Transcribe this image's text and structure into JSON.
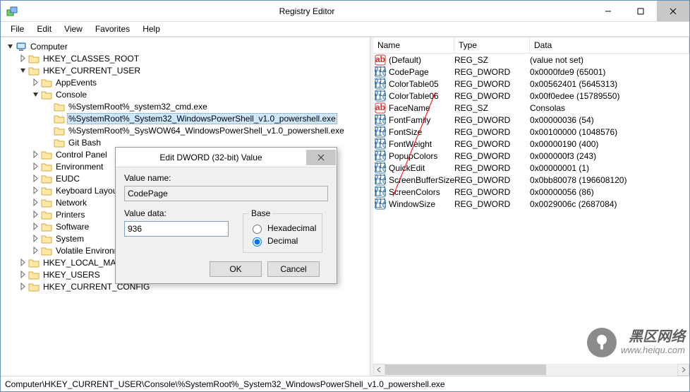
{
  "window": {
    "title": "Registry Editor"
  },
  "menubar": [
    "File",
    "Edit",
    "View",
    "Favorites",
    "Help"
  ],
  "tree": [
    {
      "depth": 0,
      "expand": "open",
      "icon": "computer",
      "label": "Computer"
    },
    {
      "depth": 1,
      "expand": "closed",
      "icon": "folder",
      "label": "HKEY_CLASSES_ROOT"
    },
    {
      "depth": 1,
      "expand": "open",
      "icon": "folder",
      "label": "HKEY_CURRENT_USER"
    },
    {
      "depth": 2,
      "expand": "closed",
      "icon": "folder",
      "label": "AppEvents"
    },
    {
      "depth": 2,
      "expand": "open",
      "icon": "folder",
      "label": "Console"
    },
    {
      "depth": 3,
      "expand": "none",
      "icon": "folder",
      "label": "%SystemRoot%_system32_cmd.exe"
    },
    {
      "depth": 3,
      "expand": "none",
      "icon": "folder",
      "label": "%SystemRoot%_System32_WindowsPowerShell_v1.0_powershell.exe",
      "selected": true
    },
    {
      "depth": 3,
      "expand": "none",
      "icon": "folder",
      "label": "%SystemRoot%_SysWOW64_WindowsPowerShell_v1.0_powershell.exe"
    },
    {
      "depth": 3,
      "expand": "none",
      "icon": "folder",
      "label": "Git Bash"
    },
    {
      "depth": 2,
      "expand": "closed",
      "icon": "folder",
      "label": "Control Panel"
    },
    {
      "depth": 2,
      "expand": "closed",
      "icon": "folder",
      "label": "Environment"
    },
    {
      "depth": 2,
      "expand": "closed",
      "icon": "folder",
      "label": "EUDC"
    },
    {
      "depth": 2,
      "expand": "closed",
      "icon": "folder",
      "label": "Keyboard Layout"
    },
    {
      "depth": 2,
      "expand": "closed",
      "icon": "folder",
      "label": "Network"
    },
    {
      "depth": 2,
      "expand": "closed",
      "icon": "folder",
      "label": "Printers"
    },
    {
      "depth": 2,
      "expand": "closed",
      "icon": "folder",
      "label": "Software"
    },
    {
      "depth": 2,
      "expand": "closed",
      "icon": "folder",
      "label": "System"
    },
    {
      "depth": 2,
      "expand": "closed",
      "icon": "folder",
      "label": "Volatile Environment"
    },
    {
      "depth": 1,
      "expand": "closed",
      "icon": "folder",
      "label": "HKEY_LOCAL_MACHINE"
    },
    {
      "depth": 1,
      "expand": "closed",
      "icon": "folder",
      "label": "HKEY_USERS"
    },
    {
      "depth": 1,
      "expand": "closed",
      "icon": "folder",
      "label": "HKEY_CURRENT_CONFIG"
    }
  ],
  "list": {
    "headers": {
      "name": "Name",
      "type": "Type",
      "data": "Data"
    },
    "rows": [
      {
        "icon": "sz",
        "name": "(Default)",
        "type": "REG_SZ",
        "data": "(value not set)"
      },
      {
        "icon": "bin",
        "name": "CodePage",
        "type": "REG_DWORD",
        "data": "0x0000fde9 (65001)"
      },
      {
        "icon": "bin",
        "name": "ColorTable05",
        "type": "REG_DWORD",
        "data": "0x00562401 (5645313)"
      },
      {
        "icon": "bin",
        "name": "ColorTable06",
        "type": "REG_DWORD",
        "data": "0x00f0edee (15789550)"
      },
      {
        "icon": "sz",
        "name": "FaceName",
        "type": "REG_SZ",
        "data": "Consolas"
      },
      {
        "icon": "bin",
        "name": "FontFamily",
        "type": "REG_DWORD",
        "data": "0x00000036 (54)"
      },
      {
        "icon": "bin",
        "name": "FontSize",
        "type": "REG_DWORD",
        "data": "0x00100000 (1048576)"
      },
      {
        "icon": "bin",
        "name": "FontWeight",
        "type": "REG_DWORD",
        "data": "0x00000190 (400)"
      },
      {
        "icon": "bin",
        "name": "PopupColors",
        "type": "REG_DWORD",
        "data": "0x000000f3 (243)"
      },
      {
        "icon": "bin",
        "name": "QuickEdit",
        "type": "REG_DWORD",
        "data": "0x00000001 (1)"
      },
      {
        "icon": "bin",
        "name": "ScreenBufferSize",
        "type": "REG_DWORD",
        "data": "0x0bb80078 (196608120)"
      },
      {
        "icon": "bin",
        "name": "ScreenColors",
        "type": "REG_DWORD",
        "data": "0x00000056 (86)"
      },
      {
        "icon": "bin",
        "name": "WindowSize",
        "type": "REG_DWORD",
        "data": "0x0029006c (2687084)"
      }
    ]
  },
  "dialog": {
    "title": "Edit DWORD (32-bit) Value",
    "value_name_label": "Value name:",
    "value_name": "CodePage",
    "value_data_label": "Value data:",
    "value_data": "936",
    "base_label": "Base",
    "radio_hex": "Hexadecimal",
    "radio_dec": "Decimal",
    "ok": "OK",
    "cancel": "Cancel"
  },
  "statusbar": "Computer\\HKEY_CURRENT_USER\\Console\\%SystemRoot%_System32_WindowsPowerShell_v1.0_powershell.exe",
  "watermark": {
    "line1": "黑区网络",
    "line2": "www.heiqu.com"
  }
}
